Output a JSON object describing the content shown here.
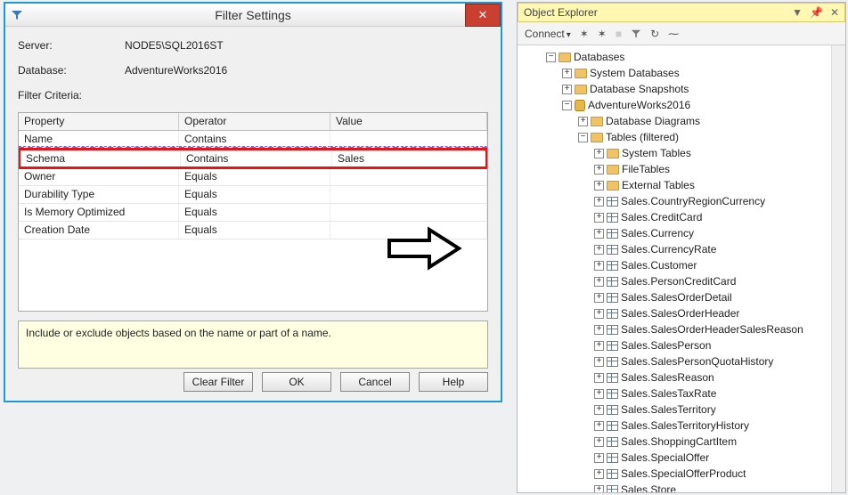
{
  "dialog": {
    "title": "Filter Settings",
    "serverLabel": "Server:",
    "serverValue": "NODE5\\SQL2016ST",
    "databaseLabel": "Database:",
    "databaseValue": "AdventureWorks2016",
    "criteriaLabel": "Filter Criteria:",
    "headers": {
      "property": "Property",
      "operator": "Operator",
      "value": "Value"
    },
    "rows": [
      {
        "property": "Name",
        "operator": "Contains",
        "value": ""
      },
      {
        "property": "Schema",
        "operator": "Contains",
        "value": "Sales"
      },
      {
        "property": "Owner",
        "operator": "Equals",
        "value": ""
      },
      {
        "property": "Durability Type",
        "operator": "Equals",
        "value": ""
      },
      {
        "property": "Is Memory Optimized",
        "operator": "Equals",
        "value": ""
      },
      {
        "property": "Creation Date",
        "operator": "Equals",
        "value": ""
      }
    ],
    "description": "Include or exclude objects based on the name or part of a name.",
    "buttons": {
      "clear": "Clear Filter",
      "ok": "OK",
      "cancel": "Cancel",
      "help": "Help"
    }
  },
  "panel": {
    "title": "Object Explorer",
    "connectLabel": "Connect",
    "tree": {
      "databases": "Databases",
      "sysdb": "System Databases",
      "snap": "Database Snapshots",
      "aw": "AdventureWorks2016",
      "diag": "Database Diagrams",
      "tablesFiltered": "Tables (filtered)",
      "systables": "System Tables",
      "filetables": "FileTables",
      "exttables": "External Tables",
      "tables": [
        "Sales.CountryRegionCurrency",
        "Sales.CreditCard",
        "Sales.Currency",
        "Sales.CurrencyRate",
        "Sales.Customer",
        "Sales.PersonCreditCard",
        "Sales.SalesOrderDetail",
        "Sales.SalesOrderHeader",
        "Sales.SalesOrderHeaderSalesReason",
        "Sales.SalesPerson",
        "Sales.SalesPersonQuotaHistory",
        "Sales.SalesReason",
        "Sales.SalesTaxRate",
        "Sales.SalesTerritory",
        "Sales.SalesTerritoryHistory",
        "Sales.ShoppingCartItem",
        "Sales.SpecialOffer",
        "Sales.SpecialOfferProduct",
        "Sales.Store"
      ]
    }
  }
}
